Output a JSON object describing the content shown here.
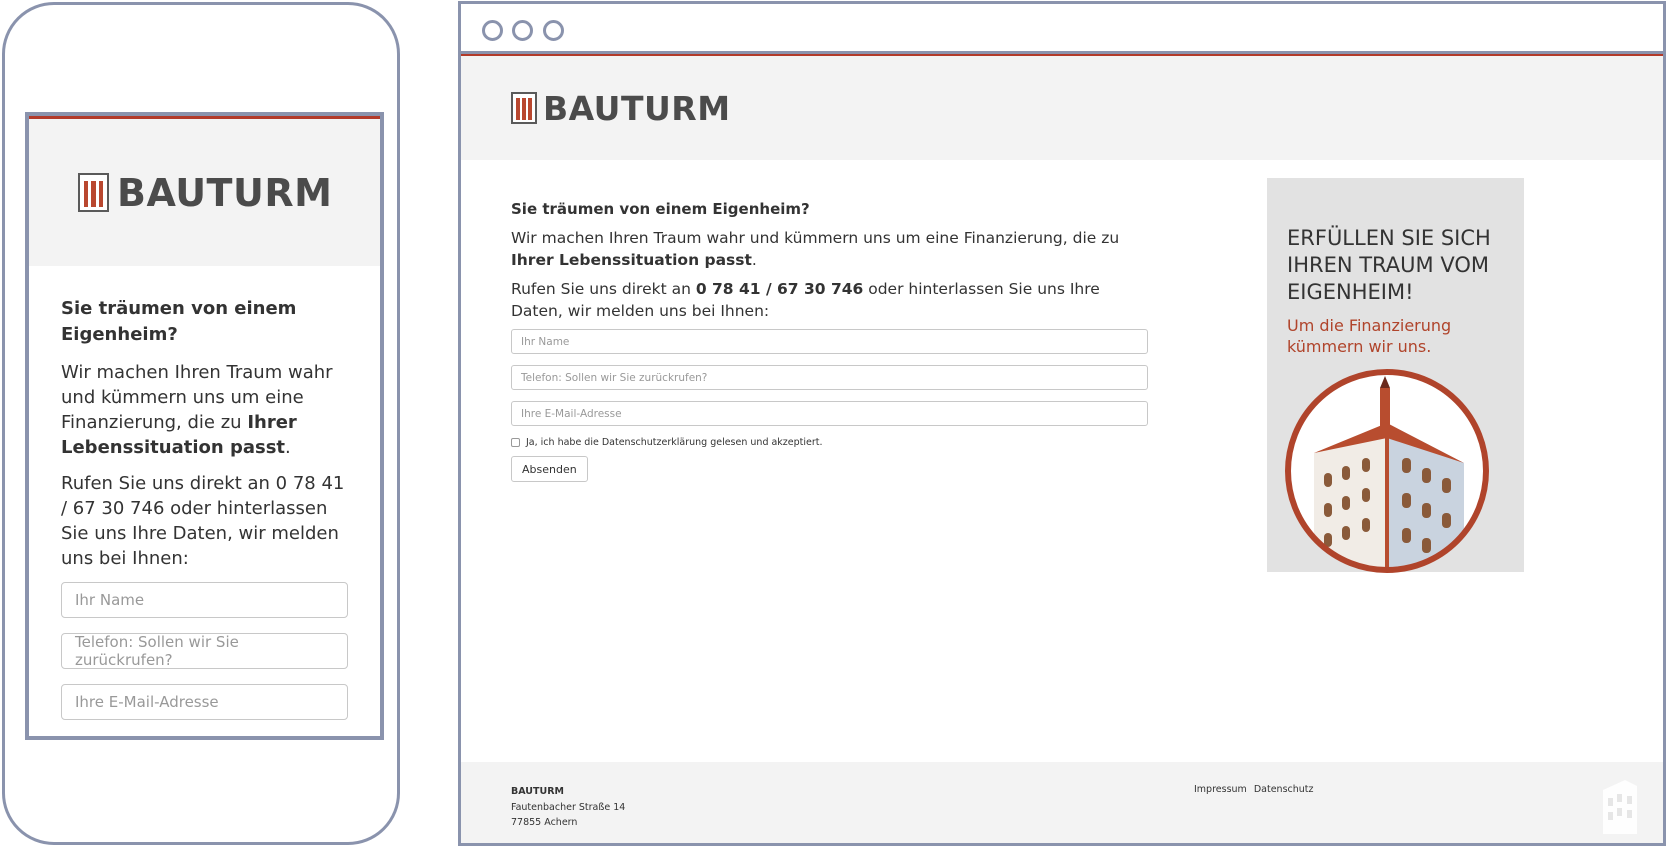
{
  "brand": {
    "name": "BAUTURM",
    "accent_color": "#b23a2a",
    "frame_color": "#8a93ad"
  },
  "mobile": {
    "headline": "Sie träumen von einem Eigenheim?",
    "intro_prefix": "Wir machen Ihren Traum wahr und kümmern uns um eine Finanzierung, die zu ",
    "intro_bold": "Ihrer Lebenssituation passt",
    "intro_suffix": ".",
    "call_text": "Rufen Sie uns direkt an 0 78 41 / 67 30 746 oder hinterlassen Sie uns Ihre Daten, wir melden uns bei Ihnen:",
    "fields": {
      "name_placeholder": "Ihr Name",
      "phone_placeholder": "Telefon: Sollen wir Sie zurückrufen?",
      "email_placeholder": "Ihre E-Mail-Adresse"
    }
  },
  "desktop": {
    "headline": "Sie träumen von einem Eigenheim?",
    "intro_prefix": "Wir machen Ihren Traum wahr und kümmern uns um eine Finanzierung, die zu ",
    "intro_bold": "Ihrer Lebenssituation passt",
    "intro_suffix": ".",
    "call_prefix": "Rufen Sie uns direkt an ",
    "phone_number": "0 78 41 / 67 30 746",
    "call_suffix": " oder hinterlassen Sie uns Ihre Daten, wir melden uns bei Ihnen:",
    "fields": {
      "name_placeholder": "Ihr Name",
      "phone_placeholder": "Telefon: Sollen wir Sie zurückrufen?",
      "email_placeholder": "Ihre E-Mail-Adresse"
    },
    "consent_label": "Ja, ich habe die Datenschutzerklärung gelesen und akzeptiert.",
    "consent_checked": false,
    "submit_label": "Absenden",
    "promo": {
      "title": "ERFÜLLEN SIE SICH IHREN TRAUM VOM EIGENHEIM!",
      "subtitle": "Um die Finanzierung kümmern wir uns."
    },
    "footer": {
      "company": "BAUTURM",
      "street": "Fautenbacher Straße 14",
      "city": "77855 Achern",
      "links": [
        "Impressum",
        "Datenschutz"
      ]
    }
  }
}
